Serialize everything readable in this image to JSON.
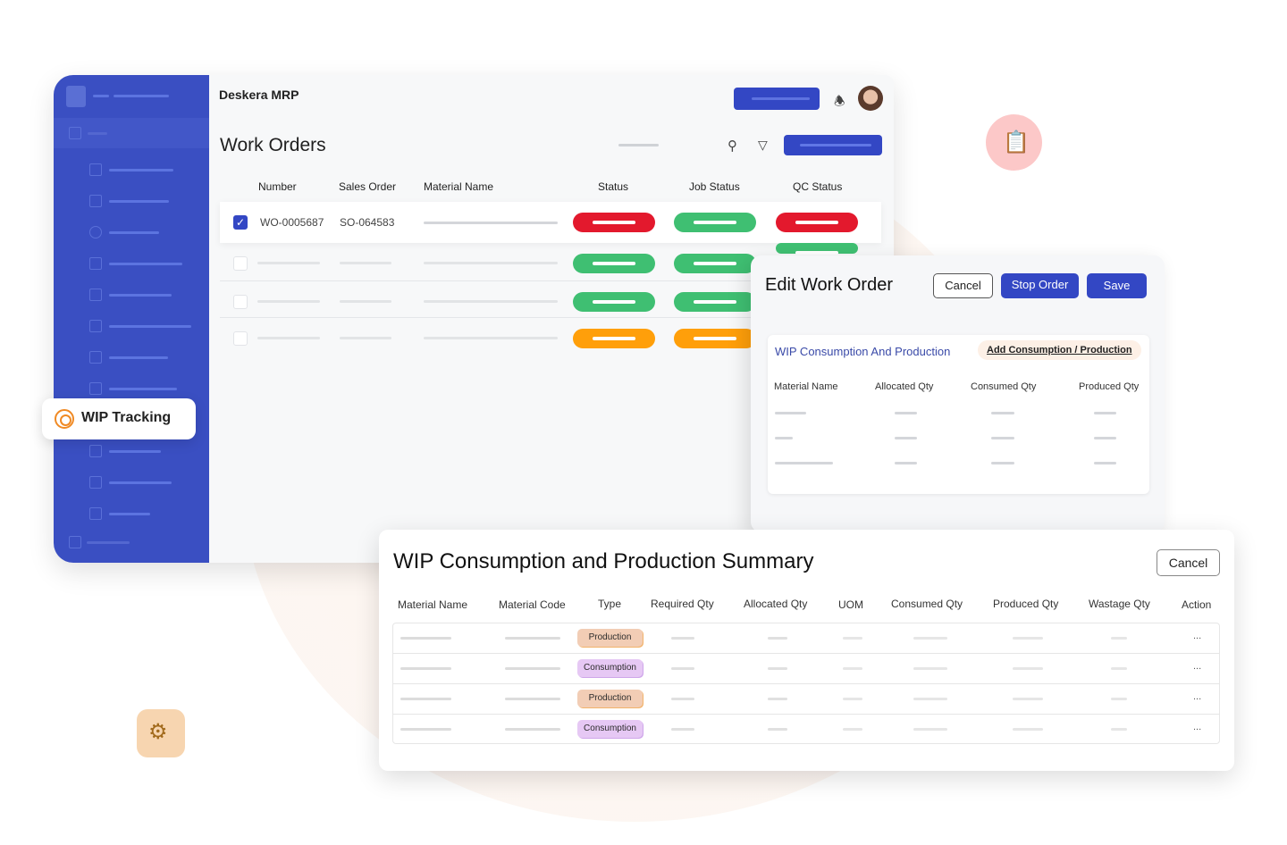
{
  "app": {
    "brand": "Deskera MRP",
    "page_title": "Work Orders",
    "icons": {
      "notifications": "bell-icon",
      "search": "search-icon",
      "filter": "filter-icon"
    }
  },
  "sidebar": {
    "highlight_item": {
      "label": "WIP Tracking",
      "icon": "wip-tracking-icon"
    }
  },
  "work_orders": {
    "columns": [
      "Number",
      "Sales Order",
      "Material Name",
      "Status",
      "Job Status",
      "QC Status"
    ],
    "rows": [
      {
        "number": "WO-0005687",
        "sales_order": "SO-064583",
        "selected": true,
        "status": "red",
        "job_status": "green",
        "qc_status": "red"
      },
      {
        "number": "",
        "sales_order": "",
        "selected": false,
        "status": "green",
        "job_status": "green",
        "qc_status": "green"
      },
      {
        "number": "",
        "sales_order": "",
        "selected": false,
        "status": "green",
        "job_status": "green",
        "qc_status": ""
      },
      {
        "number": "",
        "sales_order": "",
        "selected": false,
        "status": "orange",
        "job_status": "orange",
        "qc_status": ""
      }
    ],
    "status_colors": {
      "red": "#e3192d",
      "green": "#3fbf72",
      "orange": "#ff9f0a"
    }
  },
  "edit_work_order": {
    "title": "Edit Work Order",
    "cancel_label": "Cancel",
    "stop_label": "Stop Order",
    "save_label": "Save",
    "section_title": "WIP Consumption And Production",
    "add_link": "Add Consumption / Production",
    "columns": [
      "Material Name",
      "Allocated Qty",
      "Consumed Qty",
      "Produced Qty"
    ]
  },
  "summary": {
    "title": "WIP Consumption and Production Summary",
    "cancel_label": "Cancel",
    "columns": [
      "Material Name",
      "Material Code",
      "Type",
      "Required Qty",
      "Allocated Qty",
      "UOM",
      "Consumed Qty",
      "Produced Qty",
      "Wastage Qty",
      "Action"
    ],
    "rows": [
      {
        "type": "Production",
        "action": "..."
      },
      {
        "type": "Consumption",
        "action": "..."
      },
      {
        "type": "Production",
        "action": "..."
      },
      {
        "type": "Consumption",
        "action": "..."
      }
    ]
  },
  "decor": {
    "pink_icon": "document-stack-icon",
    "tan_icon": "machine-icon"
  },
  "colors": {
    "brand_blue": "#3347c4",
    "sidebar_blue": "#3a4fc2",
    "accent_orange": "#f08a24"
  }
}
